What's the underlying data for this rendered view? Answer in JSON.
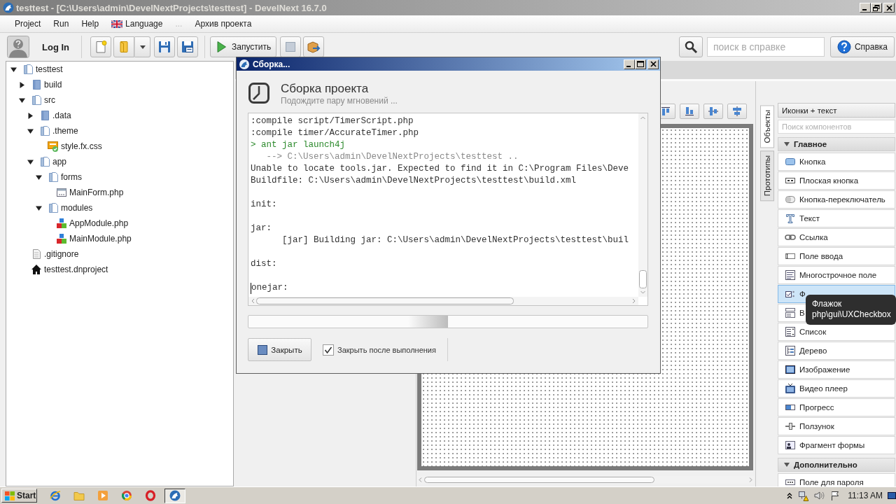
{
  "window": {
    "title": "testtest - [C:\\Users\\admin\\DevelNextProjects\\testtest] - DevelNext 16.7.0",
    "active": false
  },
  "menu": [
    {
      "label": "Project",
      "kind": "text",
      "disabled": false
    },
    {
      "label": "Run",
      "kind": "text",
      "disabled": false
    },
    {
      "label": "Help",
      "kind": "text",
      "disabled": false
    },
    {
      "label": "Language",
      "kind": "flag",
      "disabled": false
    },
    {
      "label": "...",
      "kind": "text",
      "disabled": true
    },
    {
      "label": "Архив проекта",
      "kind": "text",
      "disabled": false
    }
  ],
  "toolbar": {
    "login": "Log In",
    "run_button": "Запустить",
    "help_search": {
      "placeholder": "поиск в справке"
    },
    "help_button": "Справка"
  },
  "project_tree": [
    {
      "label": "testtest",
      "kind": "folder",
      "expanded": true,
      "children": [
        {
          "label": "build",
          "kind": "folder",
          "expanded": false
        },
        {
          "label": "src",
          "kind": "folder",
          "expanded": true,
          "children": [
            {
              "label": ".data",
              "kind": "folder",
              "expanded": false
            },
            {
              "label": ".theme",
              "kind": "folder",
              "expanded": true,
              "children": [
                {
                  "label": "style.fx.css",
                  "kind": "css"
                }
              ]
            },
            {
              "label": "app",
              "kind": "folder",
              "expanded": true,
              "children": [
                {
                  "label": "forms",
                  "kind": "folder",
                  "expanded": true,
                  "children": [
                    {
                      "label": "MainForm.php",
                      "kind": "form"
                    }
                  ]
                },
                {
                  "label": "modules",
                  "kind": "folder",
                  "expanded": true,
                  "children": [
                    {
                      "label": "AppModule.php",
                      "kind": "module"
                    },
                    {
                      "label": "MainModule.php",
                      "kind": "module"
                    }
                  ]
                }
              ]
            }
          ]
        },
        {
          "label": ".gitignore",
          "kind": "file"
        },
        {
          "label": "testtest.dnproject",
          "kind": "project"
        }
      ]
    }
  ],
  "sidebar": {
    "tabs": [
      {
        "label": "Объекты",
        "selected": true
      },
      {
        "label": "Прототипы",
        "selected": false
      }
    ],
    "view_select": "Иконки + текст",
    "search": {
      "placeholder": "Поиск компонентов"
    },
    "sections": [
      {
        "title": "Главное",
        "expanded": true,
        "items": [
          {
            "label": "Кнопка",
            "kind": "button",
            "selected": false
          },
          {
            "label": "Плоская кнопка",
            "kind": "flat-button",
            "selected": false
          },
          {
            "label": "Кнопка-переключатель",
            "kind": "toggle",
            "selected": false
          },
          {
            "label": "Текст",
            "kind": "label",
            "selected": false
          },
          {
            "label": "Ссылка",
            "kind": "link",
            "selected": false
          },
          {
            "label": "Поле ввода",
            "kind": "input",
            "selected": false
          },
          {
            "label": "Многострочное поле",
            "kind": "textarea",
            "selected": false
          },
          {
            "label": "Ф",
            "kind": "checkbox",
            "selected": true
          },
          {
            "label": "В",
            "kind": "combo",
            "selected": false
          },
          {
            "label": "Список",
            "kind": "list",
            "selected": false
          },
          {
            "label": "Дерево",
            "kind": "tree",
            "selected": false
          },
          {
            "label": "Изображение",
            "kind": "image",
            "selected": false
          },
          {
            "label": "Видео плеер",
            "kind": "video",
            "selected": false
          },
          {
            "label": "Прогресс",
            "kind": "progress",
            "selected": false
          },
          {
            "label": "Ползунок",
            "kind": "slider",
            "selected": false
          },
          {
            "label": "Фрагмент формы",
            "kind": "fragment",
            "selected": false
          }
        ]
      },
      {
        "title": "Дополнительно",
        "expanded": true,
        "items": [
          {
            "label": "Поле для пароля",
            "kind": "password",
            "selected": false
          }
        ]
      }
    ]
  },
  "tooltip": {
    "title": "Флажок",
    "text": "php\\gui\\UXCheckbox"
  },
  "dialog": {
    "title": "Сборка...",
    "active": true,
    "heading": "Сборка проекта",
    "subheading": "Подождите пару мгновений ...",
    "console": [
      {
        "kind": "plain",
        "text": ":compile script/TimerScript.php",
        "cursor": false
      },
      {
        "kind": "plain",
        "text": ":compile timer/AccurateTimer.php",
        "cursor": false
      },
      {
        "kind": "command",
        "text": "> ant jar launch4j",
        "cursor": false
      },
      {
        "kind": "dim",
        "text": "   --> C:\\Users\\admin\\DevelNextProjects\\testtest ..",
        "cursor": false
      },
      {
        "kind": "plain",
        "text": "Unable to locate tools.jar. Expected to find it in C:\\Program Files\\Deve",
        "cursor": false
      },
      {
        "kind": "plain",
        "text": "Buildfile: C:\\Users\\admin\\DevelNextProjects\\testtest\\build.xml",
        "cursor": false
      },
      {
        "kind": "blank",
        "cursor": false
      },
      {
        "kind": "plain",
        "text": "init:",
        "cursor": false
      },
      {
        "kind": "blank",
        "cursor": false
      },
      {
        "kind": "plain",
        "text": "jar:",
        "cursor": false
      },
      {
        "kind": "plain",
        "text": "      [jar] Building jar: C:\\Users\\admin\\DevelNextProjects\\testtest\\buil",
        "cursor": false
      },
      {
        "kind": "blank",
        "cursor": false
      },
      {
        "kind": "plain",
        "text": "dist:",
        "cursor": false
      },
      {
        "kind": "blank",
        "cursor": false
      },
      {
        "kind": "plain",
        "text": "onejar:",
        "cursor": true
      }
    ],
    "progress": {
      "level": 0.5
    },
    "close_button": "Закрыть",
    "close_after": {
      "label": "Закрыть после выполнения",
      "checked": true
    }
  },
  "taskbar": {
    "start": "Start",
    "apps": [
      {
        "kind": "globe",
        "selected": false
      },
      {
        "kind": "folder",
        "selected": false
      },
      {
        "kind": "player",
        "selected": false
      },
      {
        "kind": "wheel",
        "selected": false
      },
      {
        "kind": "ring",
        "selected": false
      },
      {
        "kind": "app",
        "selected": true
      }
    ],
    "clock": "11:13 AM"
  }
}
